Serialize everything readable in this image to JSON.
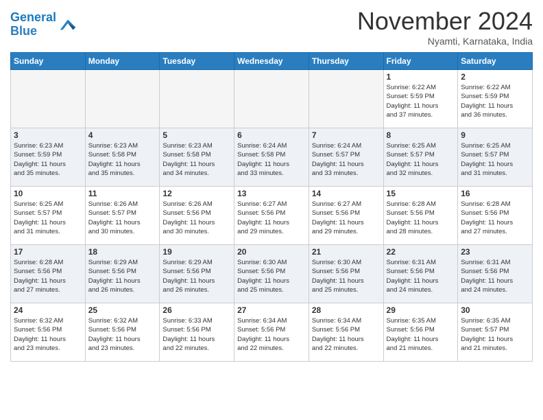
{
  "header": {
    "logo_line1": "General",
    "logo_line2": "Blue",
    "month": "November 2024",
    "location": "Nyamti, Karnataka, India"
  },
  "days_of_week": [
    "Sunday",
    "Monday",
    "Tuesday",
    "Wednesday",
    "Thursday",
    "Friday",
    "Saturday"
  ],
  "weeks": [
    [
      {
        "day": "",
        "info": ""
      },
      {
        "day": "",
        "info": ""
      },
      {
        "day": "",
        "info": ""
      },
      {
        "day": "",
        "info": ""
      },
      {
        "day": "",
        "info": ""
      },
      {
        "day": "1",
        "info": "Sunrise: 6:22 AM\nSunset: 5:59 PM\nDaylight: 11 hours\nand 37 minutes."
      },
      {
        "day": "2",
        "info": "Sunrise: 6:22 AM\nSunset: 5:59 PM\nDaylight: 11 hours\nand 36 minutes."
      }
    ],
    [
      {
        "day": "3",
        "info": "Sunrise: 6:23 AM\nSunset: 5:59 PM\nDaylight: 11 hours\nand 35 minutes."
      },
      {
        "day": "4",
        "info": "Sunrise: 6:23 AM\nSunset: 5:58 PM\nDaylight: 11 hours\nand 35 minutes."
      },
      {
        "day": "5",
        "info": "Sunrise: 6:23 AM\nSunset: 5:58 PM\nDaylight: 11 hours\nand 34 minutes."
      },
      {
        "day": "6",
        "info": "Sunrise: 6:24 AM\nSunset: 5:58 PM\nDaylight: 11 hours\nand 33 minutes."
      },
      {
        "day": "7",
        "info": "Sunrise: 6:24 AM\nSunset: 5:57 PM\nDaylight: 11 hours\nand 33 minutes."
      },
      {
        "day": "8",
        "info": "Sunrise: 6:25 AM\nSunset: 5:57 PM\nDaylight: 11 hours\nand 32 minutes."
      },
      {
        "day": "9",
        "info": "Sunrise: 6:25 AM\nSunset: 5:57 PM\nDaylight: 11 hours\nand 31 minutes."
      }
    ],
    [
      {
        "day": "10",
        "info": "Sunrise: 6:25 AM\nSunset: 5:57 PM\nDaylight: 11 hours\nand 31 minutes."
      },
      {
        "day": "11",
        "info": "Sunrise: 6:26 AM\nSunset: 5:57 PM\nDaylight: 11 hours\nand 30 minutes."
      },
      {
        "day": "12",
        "info": "Sunrise: 6:26 AM\nSunset: 5:56 PM\nDaylight: 11 hours\nand 30 minutes."
      },
      {
        "day": "13",
        "info": "Sunrise: 6:27 AM\nSunset: 5:56 PM\nDaylight: 11 hours\nand 29 minutes."
      },
      {
        "day": "14",
        "info": "Sunrise: 6:27 AM\nSunset: 5:56 PM\nDaylight: 11 hours\nand 29 minutes."
      },
      {
        "day": "15",
        "info": "Sunrise: 6:28 AM\nSunset: 5:56 PM\nDaylight: 11 hours\nand 28 minutes."
      },
      {
        "day": "16",
        "info": "Sunrise: 6:28 AM\nSunset: 5:56 PM\nDaylight: 11 hours\nand 27 minutes."
      }
    ],
    [
      {
        "day": "17",
        "info": "Sunrise: 6:28 AM\nSunset: 5:56 PM\nDaylight: 11 hours\nand 27 minutes."
      },
      {
        "day": "18",
        "info": "Sunrise: 6:29 AM\nSunset: 5:56 PM\nDaylight: 11 hours\nand 26 minutes."
      },
      {
        "day": "19",
        "info": "Sunrise: 6:29 AM\nSunset: 5:56 PM\nDaylight: 11 hours\nand 26 minutes."
      },
      {
        "day": "20",
        "info": "Sunrise: 6:30 AM\nSunset: 5:56 PM\nDaylight: 11 hours\nand 25 minutes."
      },
      {
        "day": "21",
        "info": "Sunrise: 6:30 AM\nSunset: 5:56 PM\nDaylight: 11 hours\nand 25 minutes."
      },
      {
        "day": "22",
        "info": "Sunrise: 6:31 AM\nSunset: 5:56 PM\nDaylight: 11 hours\nand 24 minutes."
      },
      {
        "day": "23",
        "info": "Sunrise: 6:31 AM\nSunset: 5:56 PM\nDaylight: 11 hours\nand 24 minutes."
      }
    ],
    [
      {
        "day": "24",
        "info": "Sunrise: 6:32 AM\nSunset: 5:56 PM\nDaylight: 11 hours\nand 23 minutes."
      },
      {
        "day": "25",
        "info": "Sunrise: 6:32 AM\nSunset: 5:56 PM\nDaylight: 11 hours\nand 23 minutes."
      },
      {
        "day": "26",
        "info": "Sunrise: 6:33 AM\nSunset: 5:56 PM\nDaylight: 11 hours\nand 22 minutes."
      },
      {
        "day": "27",
        "info": "Sunrise: 6:34 AM\nSunset: 5:56 PM\nDaylight: 11 hours\nand 22 minutes."
      },
      {
        "day": "28",
        "info": "Sunrise: 6:34 AM\nSunset: 5:56 PM\nDaylight: 11 hours\nand 22 minutes."
      },
      {
        "day": "29",
        "info": "Sunrise: 6:35 AM\nSunset: 5:56 PM\nDaylight: 11 hours\nand 21 minutes."
      },
      {
        "day": "30",
        "info": "Sunrise: 6:35 AM\nSunset: 5:57 PM\nDaylight: 11 hours\nand 21 minutes."
      }
    ]
  ]
}
